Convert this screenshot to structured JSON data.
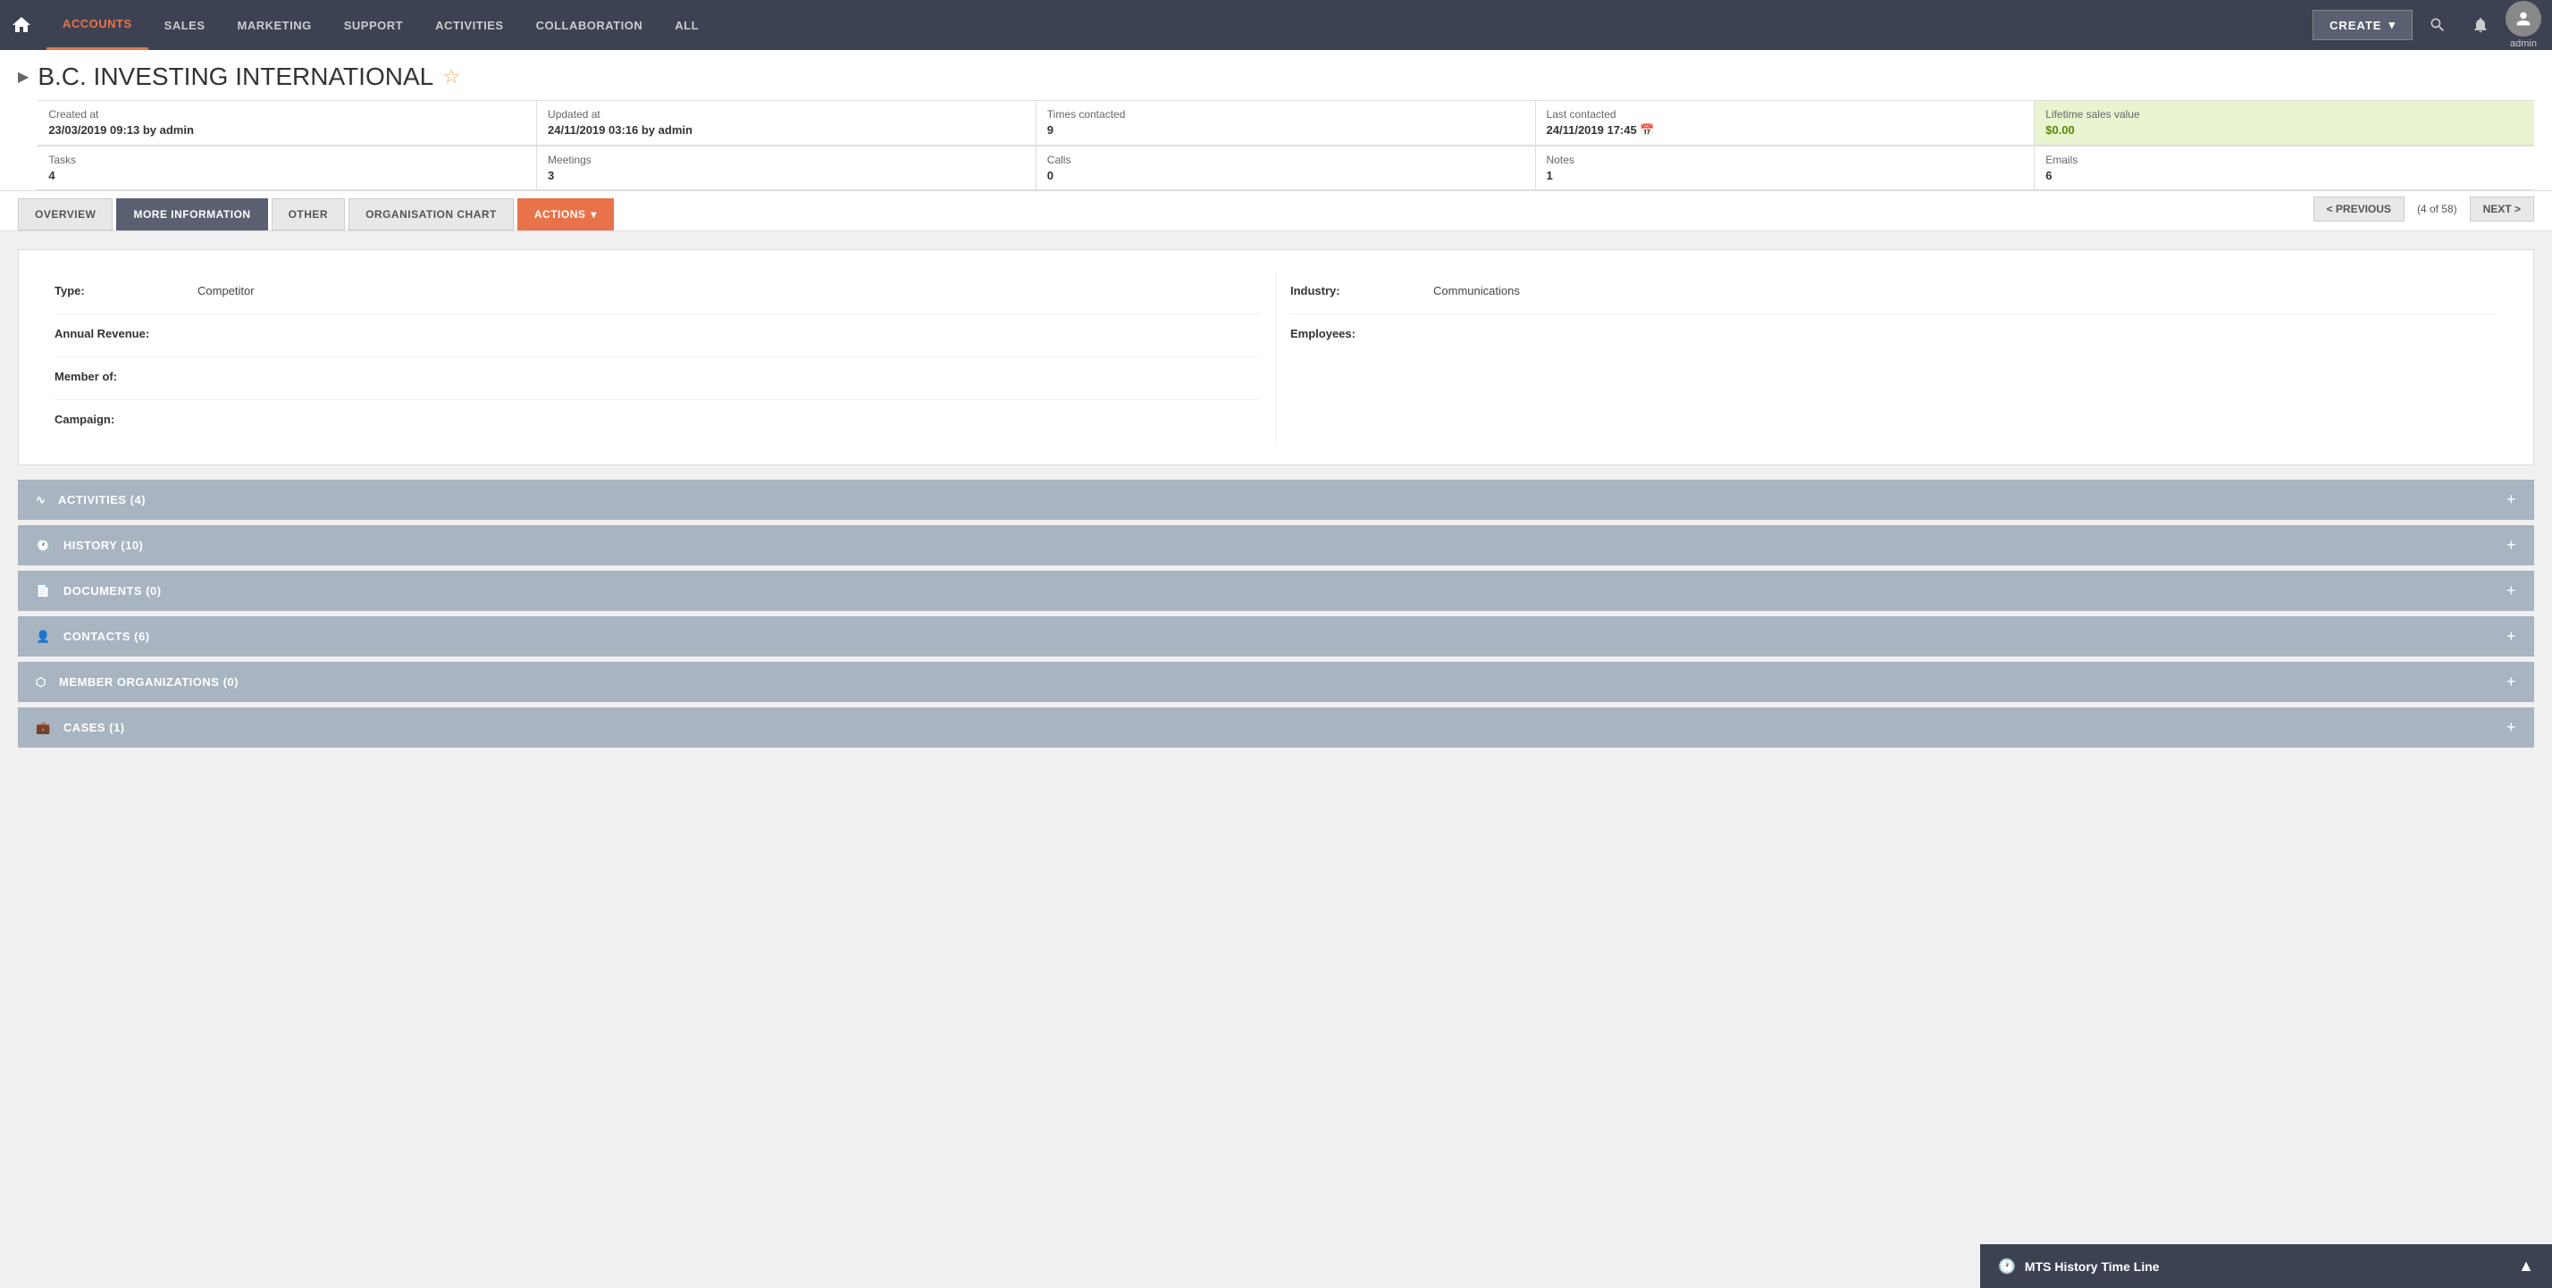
{
  "topnav": {
    "home_icon": "🏠",
    "links": [
      {
        "label": "ACCOUNTS",
        "active": true
      },
      {
        "label": "SALES",
        "active": false
      },
      {
        "label": "MARKETING",
        "active": false
      },
      {
        "label": "SUPPORT",
        "active": false
      },
      {
        "label": "ACTIVITIES",
        "active": false
      },
      {
        "label": "COLLABORATION",
        "active": false
      },
      {
        "label": "ALL",
        "active": false
      }
    ],
    "create_label": "CREATE",
    "search_icon": "🔍",
    "bell_icon": "🔔",
    "avatar_icon": "👤",
    "admin_label": "admin"
  },
  "page": {
    "title": "B.C. INVESTING INTERNATIONAL",
    "star_icon": "☆"
  },
  "meta": [
    {
      "label": "Created at",
      "value": "23/03/2019 09:13 by admin"
    },
    {
      "label": "Updated at",
      "value": "24/11/2019 03:16 by admin"
    },
    {
      "label": "Times contacted",
      "value": "9"
    },
    {
      "label": "Last contacted",
      "value": "24/11/2019 17:45 (📅)"
    },
    {
      "label": "Lifetime sales value",
      "value": "$0.00",
      "highlight": true
    }
  ],
  "meta2": [
    {
      "label": "Tasks",
      "value": "4"
    },
    {
      "label": "Meetings",
      "value": "3"
    },
    {
      "label": "Calls",
      "value": "0"
    },
    {
      "label": "Notes",
      "value": "1"
    },
    {
      "label": "Emails",
      "value": "6"
    }
  ],
  "tabs": [
    {
      "label": "OVERVIEW",
      "active": false
    },
    {
      "label": "MORE INFORMATION",
      "active": true
    },
    {
      "label": "OTHER",
      "active": false
    },
    {
      "label": "ORGANISATION CHART",
      "active": false
    },
    {
      "label": "ACTIONS",
      "active": false,
      "is_actions": true
    }
  ],
  "navigation": {
    "prev_label": "< PREVIOUS",
    "count_label": "(4 of 58)",
    "next_label": "NEXT >"
  },
  "detail_fields_left": [
    {
      "label": "Type:",
      "value": "Competitor"
    },
    {
      "label": "Annual Revenue:",
      "value": ""
    },
    {
      "label": "Member of:",
      "value": ""
    },
    {
      "label": "Campaign:",
      "value": ""
    }
  ],
  "detail_fields_right": [
    {
      "label": "Industry:",
      "value": "Communications"
    },
    {
      "label": "Employees:",
      "value": ""
    }
  ],
  "sections": [
    {
      "icon": "∿",
      "label": "ACTIVITIES (4)"
    },
    {
      "icon": "🕐",
      "label": "HISTORY (10)"
    },
    {
      "icon": "📄",
      "label": "DOCUMENTS (0)"
    },
    {
      "icon": "👤",
      "label": "CONTACTS (6)"
    },
    {
      "icon": "⬡",
      "label": "MEMBER ORGANIZATIONS (0)"
    },
    {
      "icon": "💼",
      "label": "CASES (1)"
    }
  ],
  "bottom_panel": {
    "icon": "🕐",
    "title": "MTS History Time Line",
    "collapse_icon": "▲"
  }
}
